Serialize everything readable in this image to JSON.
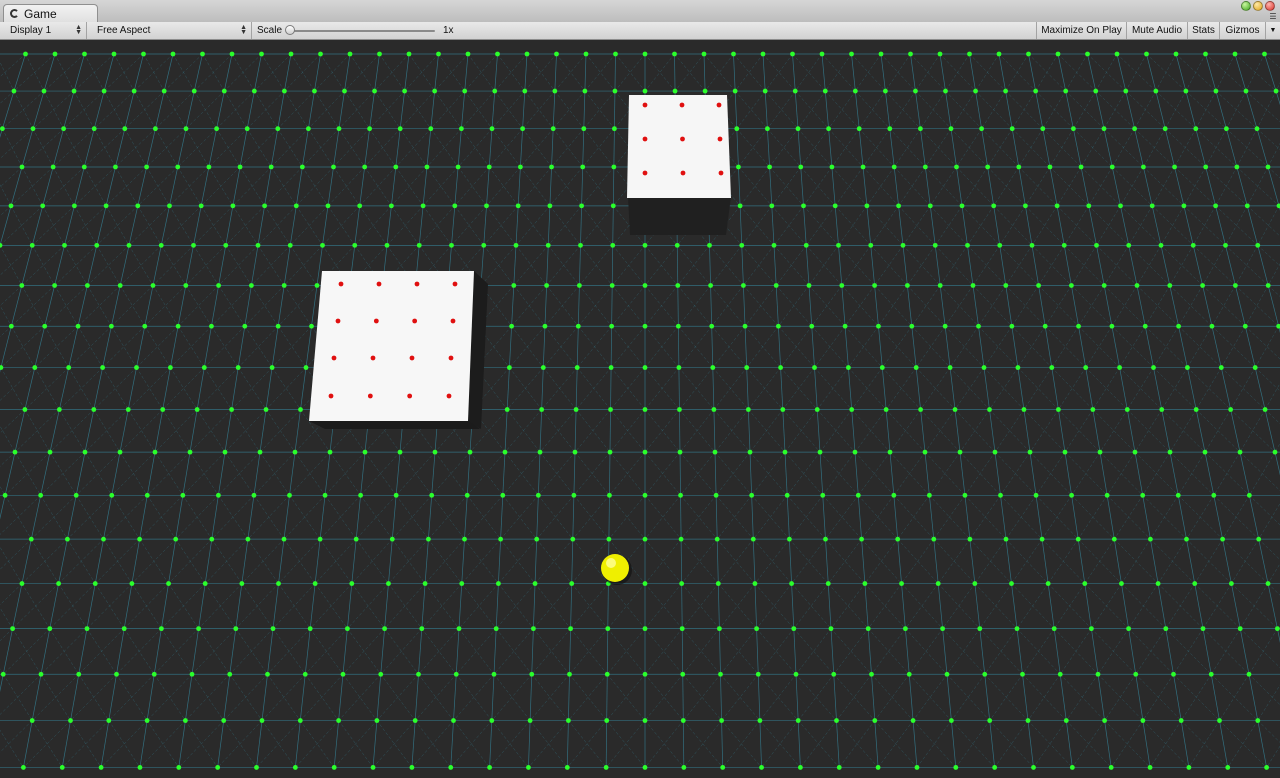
{
  "window": {
    "tab_title": "Game",
    "tab_icon": "unity-game-icon",
    "controls": [
      "zoom-button",
      "minimize-button",
      "close-button"
    ]
  },
  "toolbar": {
    "display_label": "Display 1",
    "aspect_label": "Free Aspect",
    "scale_label": "Scale",
    "scale_value": "1x",
    "scale_slider_fraction": 0.0,
    "maximize_label": "Maximize On Play",
    "mute_label": "Mute Audio",
    "stats_label": "Stats",
    "gizmos_label": "Gizmos"
  },
  "scene": {
    "background_color": "#2a2a2a",
    "grid_line_color": "#3aa7c4",
    "grid_node_color": "#2bff2b",
    "cube_face_color": "#f7f7f7",
    "cube_marker_color": "#e01010",
    "ball_color": "#f2f200",
    "objects": [
      "cube-left",
      "cube-right",
      "yellow-sphere"
    ]
  }
}
